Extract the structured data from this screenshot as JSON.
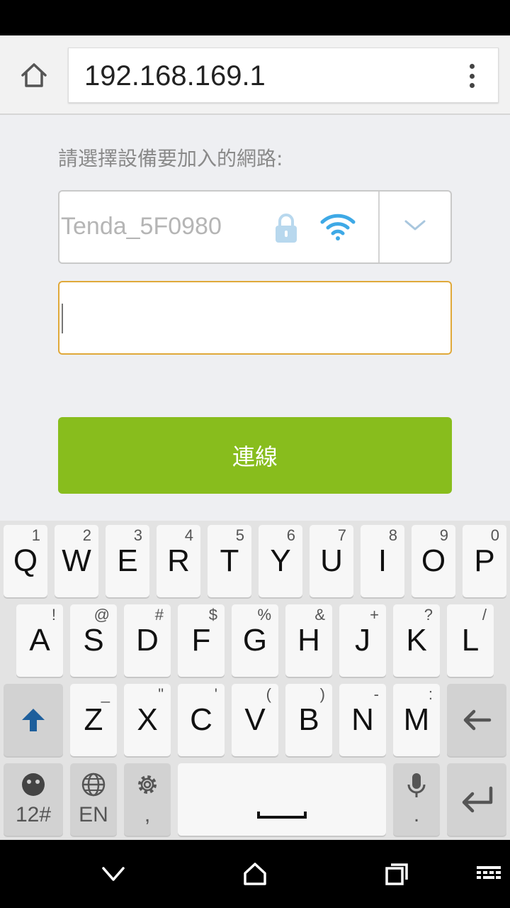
{
  "browser": {
    "url": "192.168.169.1"
  },
  "page": {
    "prompt": "請選擇設備要加入的網路:",
    "network_ssid": "Tenda_5F0980",
    "password_value": "",
    "connect_label": "連線"
  },
  "keyboard": {
    "row1": [
      {
        "key": "Q",
        "hint": "1"
      },
      {
        "key": "W",
        "hint": "2"
      },
      {
        "key": "E",
        "hint": "3"
      },
      {
        "key": "R",
        "hint": "4"
      },
      {
        "key": "T",
        "hint": "5"
      },
      {
        "key": "Y",
        "hint": "6"
      },
      {
        "key": "U",
        "hint": "7"
      },
      {
        "key": "I",
        "hint": "8"
      },
      {
        "key": "O",
        "hint": "9"
      },
      {
        "key": "P",
        "hint": "0"
      }
    ],
    "row2": [
      {
        "key": "A",
        "hint": "!"
      },
      {
        "key": "S",
        "hint": "@"
      },
      {
        "key": "D",
        "hint": "#"
      },
      {
        "key": "F",
        "hint": "$"
      },
      {
        "key": "G",
        "hint": "%"
      },
      {
        "key": "H",
        "hint": "&"
      },
      {
        "key": "J",
        "hint": "+"
      },
      {
        "key": "K",
        "hint": "?"
      },
      {
        "key": "L",
        "hint": "/"
      }
    ],
    "row3": [
      {
        "key": "Z",
        "hint": "_"
      },
      {
        "key": "X",
        "hint": "\""
      },
      {
        "key": "C",
        "hint": "'"
      },
      {
        "key": "V",
        "hint": "("
      },
      {
        "key": "B",
        "hint": ")"
      },
      {
        "key": "N",
        "hint": "-"
      },
      {
        "key": "M",
        "hint": ":"
      }
    ],
    "symbols_label": "12#",
    "language_label": "EN",
    "comma_label": ",",
    "period_label": "."
  },
  "colors": {
    "connect_button": "#88bd1d",
    "input_focus_border": "#e0a93a",
    "wifi_icon": "#3ea9e6",
    "lock_icon": "#b8d8ee",
    "shift_arrow": "#1e5f9c"
  }
}
